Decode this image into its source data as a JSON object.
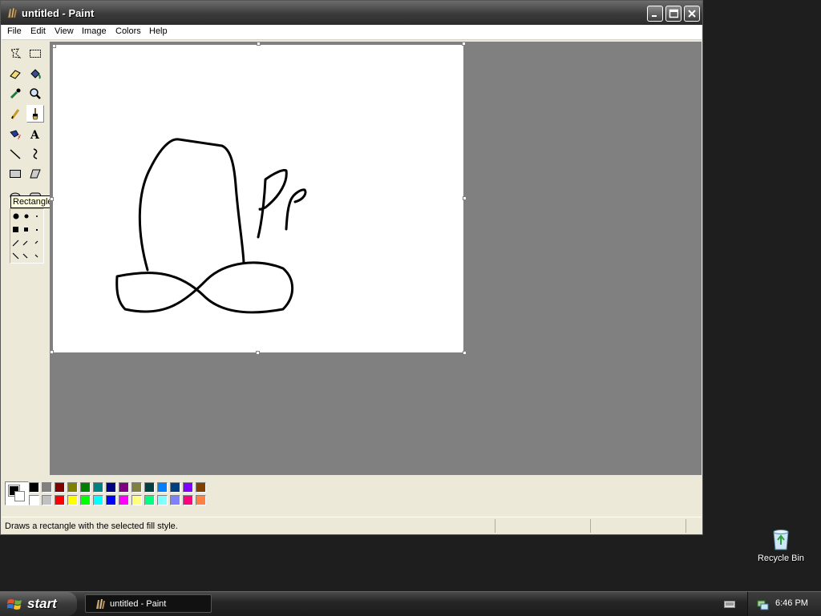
{
  "window": {
    "title": "untitled - Paint",
    "controls": [
      "minimize",
      "maximize",
      "close"
    ]
  },
  "menu": [
    "File",
    "Edit",
    "View",
    "Image",
    "Colors",
    "Help"
  ],
  "toolbox": {
    "tools": [
      {
        "name": "free-form-select"
      },
      {
        "name": "select"
      },
      {
        "name": "eraser"
      },
      {
        "name": "fill-with-color"
      },
      {
        "name": "pick-color"
      },
      {
        "name": "magnifier"
      },
      {
        "name": "pencil"
      },
      {
        "name": "brush",
        "active": true
      },
      {
        "name": "airbrush"
      },
      {
        "name": "text"
      },
      {
        "name": "line"
      },
      {
        "name": "curve"
      },
      {
        "name": "rectangle"
      },
      {
        "name": "polygon"
      },
      {
        "name": "ellipse"
      },
      {
        "name": "rounded-rectangle"
      }
    ],
    "tooltip": "Rectangle"
  },
  "palette": {
    "foreground": "#000000",
    "background": "#ffffff",
    "row1": [
      "#000000",
      "#808080",
      "#800000",
      "#808000",
      "#008000",
      "#008080",
      "#000080",
      "#800080",
      "#808040",
      "#004040",
      "#0080ff",
      "#004080",
      "#8000ff",
      "#804000"
    ],
    "row2": [
      "#ffffff",
      "#c0c0c0",
      "#ff0000",
      "#ffff00",
      "#00ff00",
      "#00ffff",
      "#0000ff",
      "#ff00ff",
      "#ffff80",
      "#00ff80",
      "#80ffff",
      "#8080ff",
      "#ff0080",
      "#ff8040"
    ]
  },
  "status": {
    "text": "Draws a rectangle with the selected fill style."
  },
  "desktop": {
    "recycle_bin_label": "Recycle Bin"
  },
  "taskbar": {
    "start_label": "start",
    "task_label": "untitled - Paint",
    "clock": "6:46 PM"
  }
}
